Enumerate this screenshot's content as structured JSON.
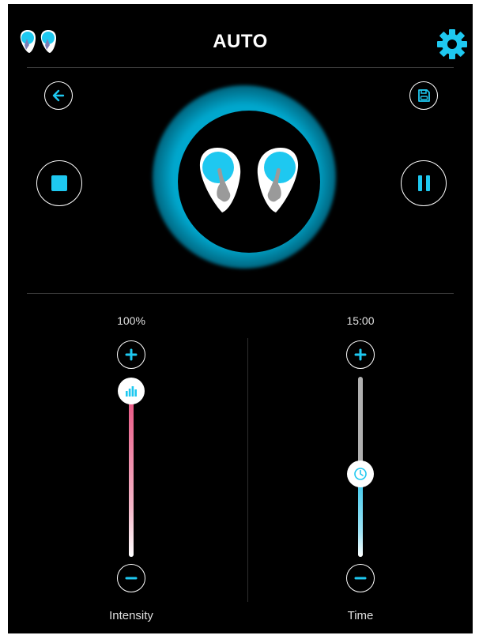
{
  "header": {
    "title": "AUTO"
  },
  "icons": {
    "logo": "pods-logo-icon",
    "settings": "gear-icon",
    "back": "arrow-left-icon",
    "save": "save-icon",
    "stop": "stop-icon",
    "pause": "pause-icon",
    "device": "pods-device-icon"
  },
  "intensity": {
    "value_text": "100%",
    "label": "Intensity",
    "level": 1.0,
    "knob_icon": "bar-chart-icon"
  },
  "time": {
    "value_text": "15:00",
    "label": "Time",
    "level": 0.46,
    "knob_icon": "clock-icon"
  },
  "colors": {
    "accent": "#1ec8f0",
    "intensity_fill": "#e8507f",
    "time_fill": "#32c6ec",
    "track_gray": "#b0b0b0"
  }
}
